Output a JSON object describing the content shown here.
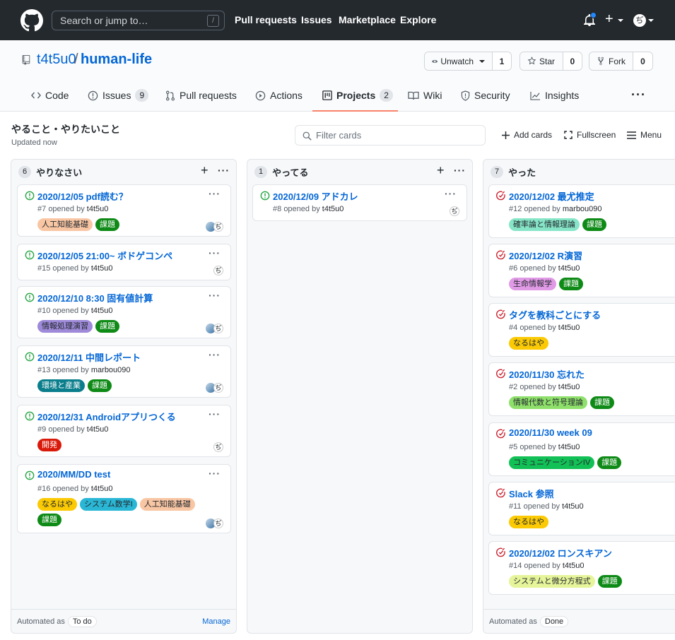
{
  "topbar": {
    "search_placeholder": "Search or jump to…",
    "search_key": "/",
    "nav": [
      "Pull requests",
      "Issues",
      "Marketplace",
      "Explore"
    ]
  },
  "repo": {
    "owner": "t4t5u0",
    "separator": "/",
    "name": "human-life",
    "watch": {
      "label": "Unwatch",
      "count": "1"
    },
    "star": {
      "label": "Star",
      "count": "0"
    },
    "fork": {
      "label": "Fork",
      "count": "0"
    }
  },
  "tabs": [
    {
      "label": "Code"
    },
    {
      "label": "Issues",
      "count": "9"
    },
    {
      "label": "Pull requests"
    },
    {
      "label": "Actions"
    },
    {
      "label": "Projects",
      "count": "2",
      "selected": true
    },
    {
      "label": "Wiki"
    },
    {
      "label": "Security"
    },
    {
      "label": "Insights"
    }
  ],
  "project": {
    "title": "やること・やりたいこと",
    "updated": "Updated now",
    "filter_placeholder": "Filter cards",
    "add_cards": "Add cards",
    "fullscreen": "Fullscreen",
    "menu": "Menu"
  },
  "columns": [
    {
      "count": "6",
      "title": "やりなさい",
      "automated_label": "Automated as",
      "automated_value": "To do",
      "manage": "Manage",
      "cards": [
        {
          "title": "2020/12/05 pdf読む？",
          "num": "#7",
          "opened": "opened by",
          "author": "t4t5u0",
          "labels": [
            [
              "人工知能基礎",
              "#f9c6a4",
              "#24292e"
            ],
            [
              "課題",
              "#0e8a16",
              "#ffffff"
            ]
          ],
          "assignees": 2
        },
        {
          "title": "2020/12/05 21:00~ ボドゲコンペ",
          "num": "#15",
          "opened": "opened by",
          "author": "t4t5u0",
          "labels": [],
          "assignees": 1
        },
        {
          "title": "2020/12/10 8:30 固有値計算",
          "num": "#10",
          "opened": "opened by",
          "author": "t4t5u0",
          "labels": [
            [
              "情報処理演習",
              "#9e8ad9",
              "#24292e"
            ],
            [
              "課題",
              "#0e8a16",
              "#ffffff"
            ]
          ],
          "assignees": 2
        },
        {
          "title": "2020/12/11 中間レポート",
          "num": "#13",
          "opened": "opened by",
          "author": "marbou090",
          "labels": [
            [
              "環境と産業",
              "#0a7e8c",
              "#ffffff"
            ],
            [
              "課題",
              "#0e8a16",
              "#ffffff"
            ]
          ],
          "assignees": 2
        },
        {
          "title": "2020/12/31 Androidアプリつくる",
          "num": "#9",
          "opened": "opened by",
          "author": "t4t5u0",
          "labels": [
            [
              "開発",
              "#d91a0b",
              "#ffffff"
            ]
          ],
          "assignees": 1
        },
        {
          "title": "2020/MM/DD test",
          "num": "#16",
          "opened": "opened by",
          "author": "t4t5u0",
          "labels": [
            [
              "なるはや",
              "#fbca04",
              "#24292e"
            ],
            [
              "システム数学I",
              "#2ab7d6",
              "#24292e"
            ],
            [
              "人工知能基礎",
              "#f9c6a4",
              "#24292e"
            ],
            [
              "課題",
              "#0e8a16",
              "#ffffff"
            ]
          ],
          "assignees": 2
        }
      ]
    },
    {
      "count": "1",
      "title": "やってる",
      "cards": [
        {
          "title": "2020/12/09 アドカレ",
          "num": "#8",
          "opened": "opened by",
          "author": "t4t5u0",
          "labels": [],
          "assignees": 1
        }
      ]
    },
    {
      "count": "7",
      "title": "やった",
      "automated_label": "Automated as",
      "automated_value": "Done",
      "cards": [
        {
          "title": "2020/12/02 最尤推定",
          "num": "#12",
          "opened": "opened by",
          "author": "marbou090",
          "labels": [
            [
              "確率論と情報理論",
              "#86e5c7",
              "#24292e"
            ],
            [
              "課題",
              "#0e8a16",
              "#ffffff"
            ]
          ]
        },
        {
          "title": "2020/12/02 R演習",
          "num": "#6",
          "opened": "opened by",
          "author": "t4t5u0",
          "labels": [
            [
              "生命情報学",
              "#e19ae6",
              "#24292e"
            ],
            [
              "課題",
              "#0e8a16",
              "#ffffff"
            ]
          ]
        },
        {
          "title": "タグを教科ごとにする",
          "num": "#4",
          "opened": "opened by",
          "author": "t4t5u0",
          "labels": [
            [
              "なるはや",
              "#fbca04",
              "#24292e"
            ]
          ]
        },
        {
          "title": "2020/11/30 忘れた",
          "num": "#2",
          "opened": "opened by",
          "author": "t4t5u0",
          "labels": [
            [
              "情報代数と符号理論",
              "#8ee06b",
              "#24292e"
            ],
            [
              "課題",
              "#0e8a16",
              "#ffffff"
            ]
          ]
        },
        {
          "title": "2020/11/30 week 09",
          "num": "#5",
          "opened": "opened by",
          "author": "t4t5u0",
          "labels": [
            [
              "コミュニケーションIV",
              "#12c156",
              "#24292e"
            ],
            [
              "課題",
              "#0e8a16",
              "#ffffff"
            ]
          ]
        },
        {
          "title": "Slack 参照",
          "num": "#11",
          "opened": "opened by",
          "author": "t4t5u0",
          "labels": [
            [
              "なるはや",
              "#fbca04",
              "#24292e"
            ]
          ]
        },
        {
          "title": "2020/12/02 ロンスキアン",
          "num": "#14",
          "opened": "opened by",
          "author": "t4t5u0",
          "labels": [
            [
              "システムと微分方程式",
              "#e6f59a",
              "#24292e"
            ],
            [
              "課題",
              "#0e8a16",
              "#ffffff"
            ]
          ]
        }
      ]
    }
  ]
}
